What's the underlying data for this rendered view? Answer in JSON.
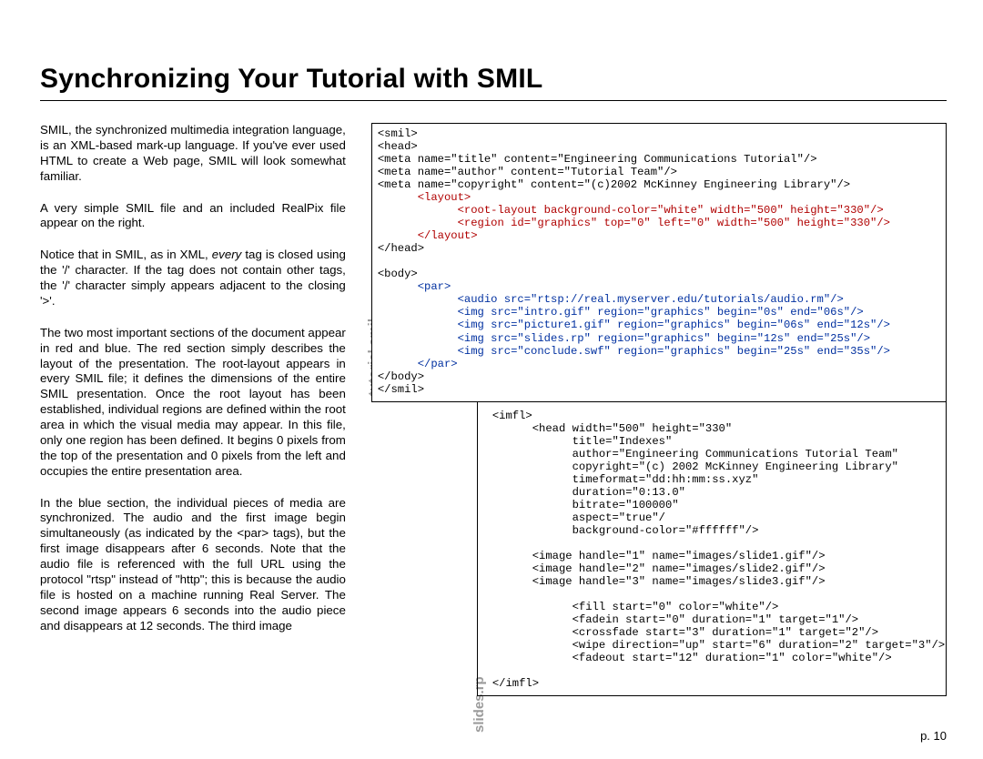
{
  "title": "Synchronizing Your Tutorial with SMIL",
  "left": {
    "p1": "SMIL, the synchronized multimedia integration language, is an XML-based mark-up language. If you've ever used HTML to create a Web page, SMIL will look somewhat familiar.",
    "p2": "A very simple SMIL file and an included RealPix file appear on the right.",
    "p3a": "Notice that in SMIL, as in XML, ",
    "p3em": "every",
    "p3b": " tag is closed using the '/' character. If the tag does not contain other tags, the '/' character simply appears adjacent to the closing '>'.",
    "p4": "The two most important sections of the document appear in red and blue. The red section simply describes the layout of the presentation. The root-layout appears in every SMIL file; it defines the dimensions of the entire SMIL presentation. Once the root layout has been established, individual regions are defined within the root area in which the visual media may appear. In this file, only one region has been defined. It begins 0 pixels from the top of the presentation and 0 pixels from the left and occupies the entire presentation area.",
    "p5": "In the blue section, the individual pieces of media are synchronized. The audio and the first image begin simultaneously (as indicated by the <par> tags), but the first image disappears after 6 seconds. Note that the audio file is referenced with the full URL using the protocol \"rtsp\" instead of \"http\"; this is because the audio file is hosted on a machine running Real Server. The second image appears 6 seconds into the audio piece and disappears at 12 seconds. The third image"
  },
  "labels": {
    "smil": "tutorial.smil",
    "rp": "slides.rp"
  },
  "smil": {
    "l1": "<smil>",
    "l2": "<head>",
    "l3": "<meta name=\"title\" content=\"Engineering Communications Tutorial\"/>",
    "l4": "<meta name=\"author\" content=\"Tutorial Team\"/>",
    "l5": "<meta name=\"copyright\" content=\"(c)2002 McKinney Engineering Library\"/>",
    "l6": "<layout>",
    "l7": "<root-layout background-color=\"white\" width=\"500\" height=\"330\"/>",
    "l8": "<region id=\"graphics\" top=\"0\" left=\"0\" width=\"500\" height=\"330\"/>",
    "l9": "</layout>",
    "l10": "</head>",
    "l11": "",
    "l12": "<body>",
    "l13": "<par>",
    "l14": "<audio src=\"rtsp://real.myserver.edu/tutorials/audio.rm\"/>",
    "l15": "<img src=\"intro.gif\" region=\"graphics\" begin=\"0s\" end=\"06s\"/>",
    "l16": "<img src=\"picture1.gif\" region=\"graphics\" begin=\"06s\" end=\"12s\"/>",
    "l17": "<img src=\"slides.rp\" region=\"graphics\" begin=\"12s\" end=\"25s\"/>",
    "l18": "<img src=\"conclude.swf\" region=\"graphics\" begin=\"25s\" end=\"35s\"/>",
    "l19": "</par>",
    "l20": "</body>",
    "l21": "</smil>"
  },
  "rp": {
    "l1": "<imfl>",
    "l2": "<head width=\"500\" height=\"330\"",
    "l3": "title=\"Indexes\"",
    "l4": "author=\"Engineering Communications Tutorial Team\"",
    "l5": "copyright=\"(c) 2002 McKinney Engineering Library\"",
    "l6": "timeformat=\"dd:hh:mm:ss.xyz\"",
    "l7": "duration=\"0:13.0\"",
    "l8": "bitrate=\"100000\"",
    "l9": "aspect=\"true\"/",
    "l10": "background-color=\"#ffffff\"/>",
    "l11": "",
    "l12": "<image handle=\"1\" name=\"images/slide1.gif\"/>",
    "l13": "<image handle=\"2\" name=\"images/slide2.gif\"/>",
    "l14": "<image handle=\"3\" name=\"images/slide3.gif\"/>",
    "l15": "",
    "l16": "<fill start=\"0\" color=\"white\"/>",
    "l17": "<fadein start=\"0\" duration=\"1\" target=\"1\"/>",
    "l18": "<crossfade start=\"3\" duration=\"1\" target=\"2\"/>",
    "l19": "<wipe direction=\"up\" start=\"6\" duration=\"2\" target=\"3\"/>",
    "l20": "<fadeout start=\"12\" duration=\"1\" color=\"white\"/>",
    "l21": "",
    "l22": "</imfl>"
  },
  "pagenum": "p. 10"
}
